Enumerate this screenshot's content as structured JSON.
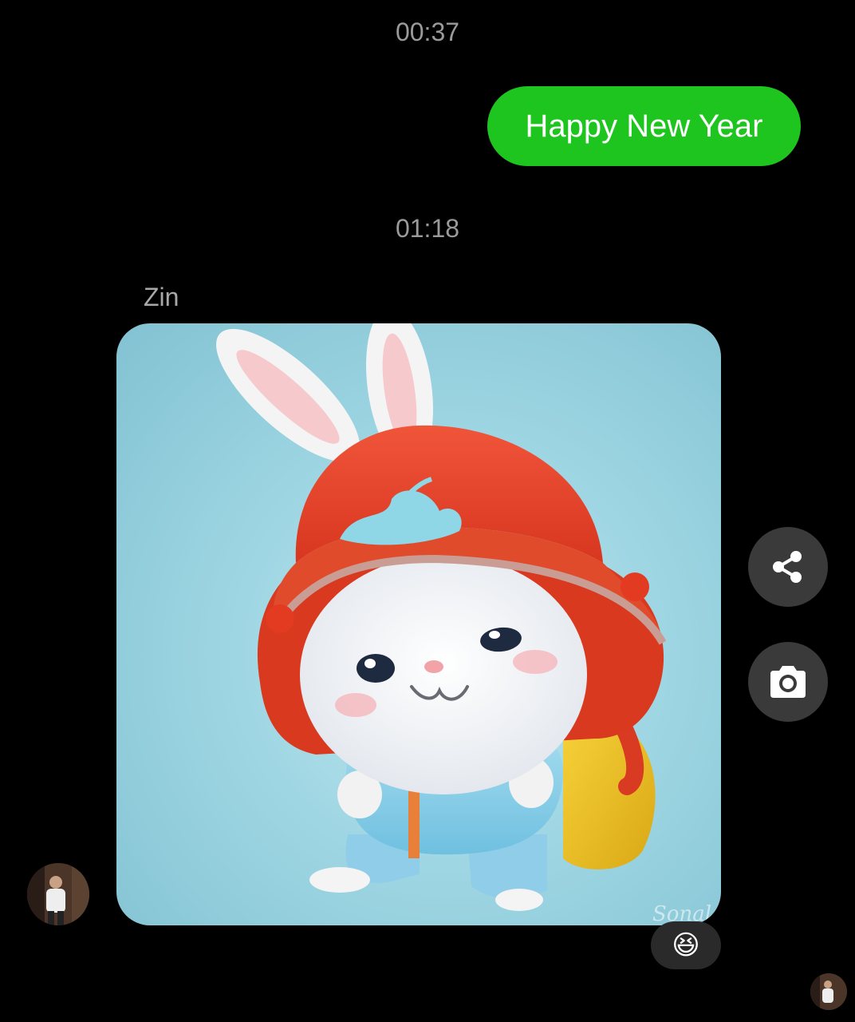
{
  "timestamps": {
    "first": "00:37",
    "second": "01:18"
  },
  "outgoing_message": {
    "text": "Happy New Year",
    "bubble_color": "#1ec51e"
  },
  "incoming_message": {
    "sender": "Zin",
    "type": "image",
    "image_subject": "bunny-with-red-hat-and-yellow-backpack",
    "watermark": "Sonal"
  },
  "side_actions": {
    "share_icon": "share-icon",
    "camera_icon": "camera-icon"
  },
  "reaction": {
    "emoji": "😆"
  },
  "colors": {
    "background": "#000000",
    "timestamp": "#9a9a9a",
    "sender_name": "#a8a8a8",
    "button_bg": "#3a3a3a"
  }
}
